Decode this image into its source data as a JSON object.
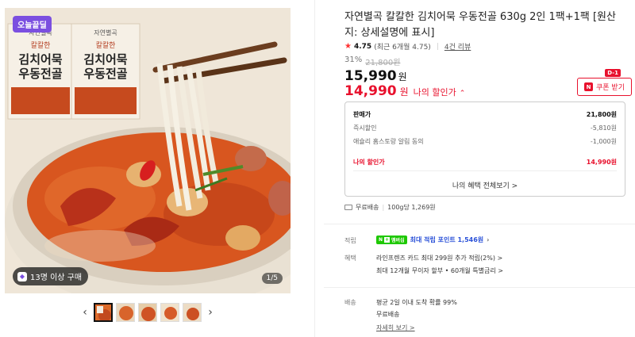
{
  "gallery": {
    "badge": "오늘끝딜",
    "buyers": "13명 이상 구매",
    "page_indicator": "1/5",
    "package_brand": "자연별곡",
    "package_subtitle": "칼칼한",
    "package_title_1": "김치어묵",
    "package_title_2": "우동전골",
    "thumbnails": 5,
    "active_thumbnail": 1
  },
  "product": {
    "title": "자연별곡 칼칼한 김치어묵 우동전골 630g 2인 1팩+1팩 [원산지: 상세설명에 표시]",
    "rating": "4.75",
    "rating_detail": "(최근 6개월 4.75)",
    "review_count": "4건 리뷰",
    "discount_pct": "31%",
    "original_price": "21,800원",
    "price": "15,990",
    "price_unit": "원",
    "my_price": "14,990",
    "my_price_unit": "원",
    "my_price_label": "나의 할인가",
    "dday": "D-1",
    "coupon_label": "쿠폰 받기"
  },
  "price_box": {
    "rows": [
      {
        "label": "판매가",
        "value": "21,800원"
      },
      {
        "label": "즉시할인",
        "value": "-5,810원"
      },
      {
        "label": "애슐리 홈스토랑 알림 동의",
        "value": "-1,000원"
      }
    ],
    "my_label": "나의 할인가",
    "my_value": "14,990원",
    "all_benefits": "나의 혜택 전체보기 >"
  },
  "shipping": {
    "free": "무료배송",
    "unit_price": "100g당 1,269원"
  },
  "details": {
    "points_label": "적립",
    "points_badge": "멤버십",
    "points_text": "최대 적립 포인트 1,546원",
    "benefit_label": "혜택",
    "benefit_line1": "라인프렌즈 카드 최대 299원 추가 적립(2%) >",
    "benefit_line2": "최대 12개월 무이자 할부 • 60개월 특별금리 >",
    "delivery_label": "배송",
    "delivery_line1": "평균 2일 이내 도착 확률 99%",
    "delivery_line2": "무료배송",
    "delivery_more": "자세히 보기 >"
  },
  "colors": {
    "accent_red": "#e8112d",
    "badge_purple": "#7b4fe0",
    "naver_green": "#1ec800",
    "points_blue": "#2a51d8"
  }
}
